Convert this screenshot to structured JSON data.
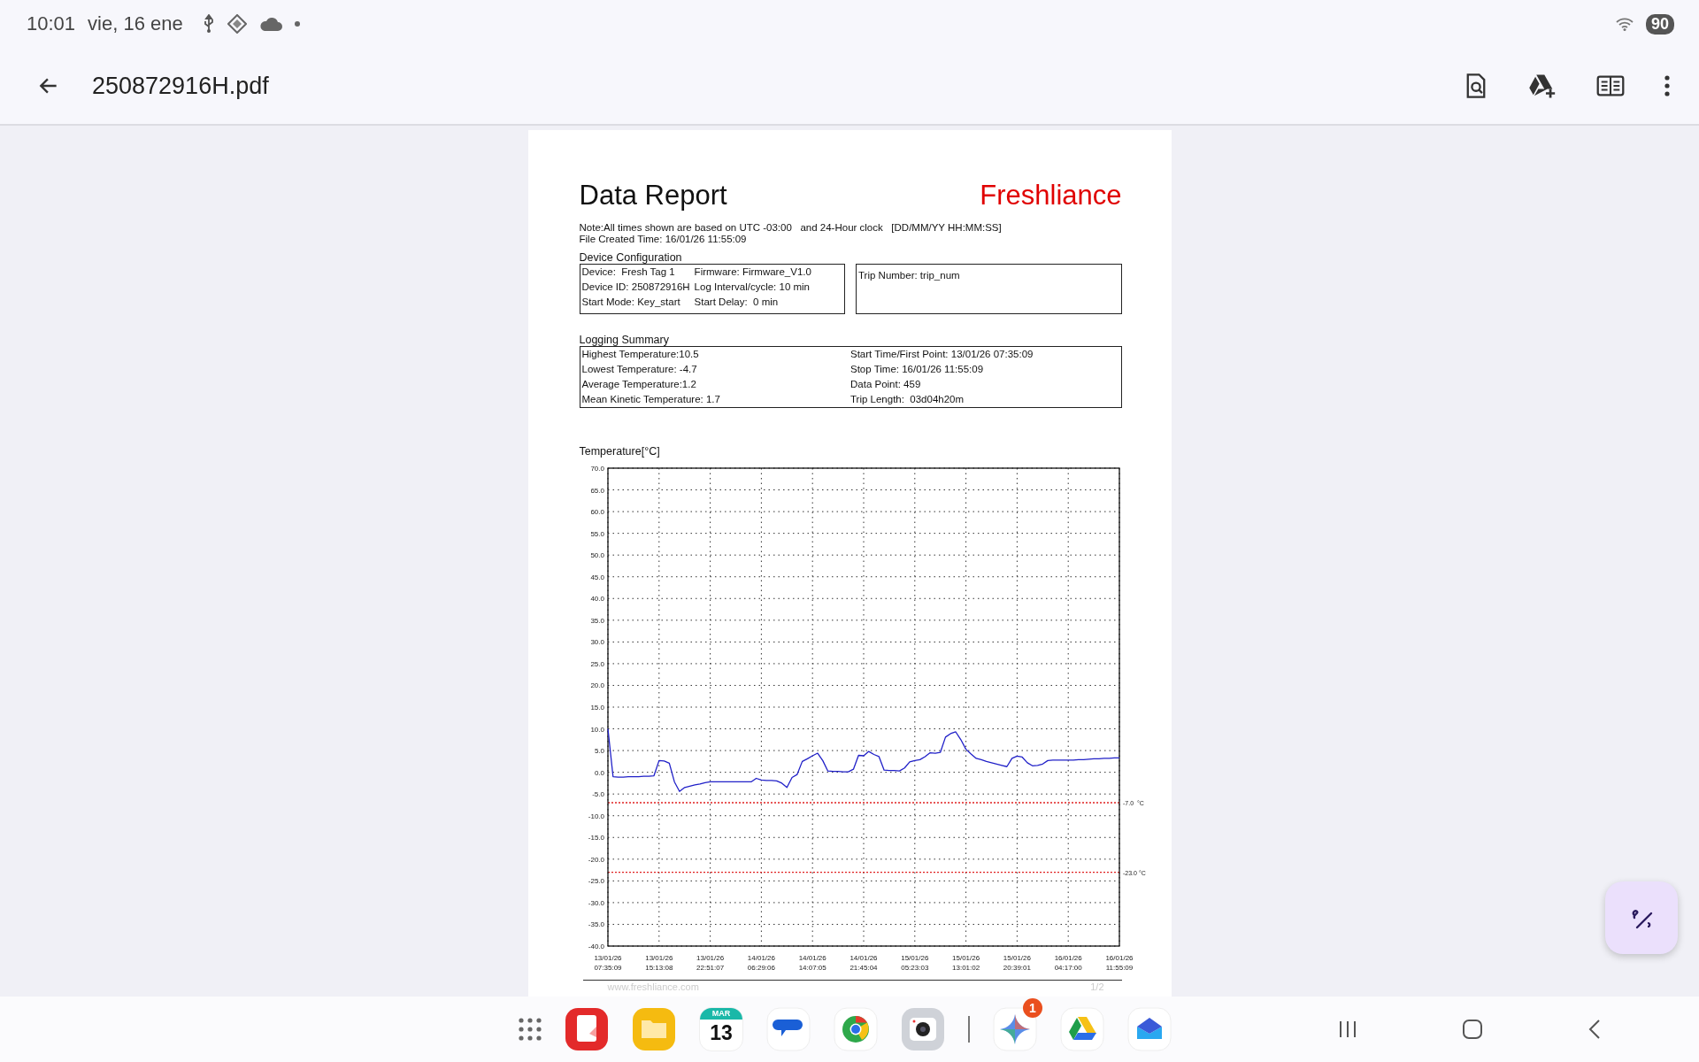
{
  "status_bar": {
    "time": "10:01",
    "date": "vie, 16 ene",
    "battery": "90"
  },
  "toolbar": {
    "title": "250872916H.pdf"
  },
  "report": {
    "title": "Data Report",
    "brand": "Freshliance",
    "note": "Note:All times shown are based on UTC -03:00   and 24-Hour clock   [DD/MM/YY HH:MM:SS]",
    "created": "File Created Time: 16/01/26 11:55:09",
    "device_config": {
      "heading": "Device Configuration",
      "rows": [
        [
          "Device:  Fresh Tag 1",
          "Firmware: Firmware_V1.0"
        ],
        [
          "Device ID: 250872916H",
          "Log Interval/cycle: 10 min"
        ],
        [
          "Start Mode: Key_start",
          "Start Delay:  0 min"
        ]
      ],
      "trip": "Trip Number: trip_num"
    },
    "logging_summary": {
      "heading": "Logging Summary",
      "left": [
        "Highest Temperature:10.5",
        "Lowest Temperature: -4.7",
        "Average Temperature:1.2",
        "Mean Kinetic Temperature: 1.7"
      ],
      "right": [
        "Start Time/First Point: 13/01/26 07:35:09",
        "Stop Time: 16/01/26 11:55:09",
        "Data Point: 459",
        "Trip Length:  03d04h20m"
      ]
    },
    "chart_data": {
      "type": "line",
      "title": "Temperature[°C]",
      "categories": [
        "13/01/26 07:35:09",
        null,
        null,
        null,
        null,
        null,
        null,
        null,
        null,
        null,
        "13/01/26 15:13:08",
        null,
        null,
        null,
        null,
        null,
        null,
        null,
        null,
        null,
        "13/01/26 22:51:07",
        null,
        null,
        null,
        null,
        null,
        null,
        null,
        null,
        null,
        "14/01/26 06:29:06",
        null,
        null,
        null,
        null,
        null,
        null,
        null,
        null,
        null,
        "14/01/26 14:07:05",
        null,
        null,
        null,
        null,
        null,
        null,
        null,
        null,
        null,
        "14/01/26 21:45:04",
        null,
        null,
        null,
        null,
        null,
        null,
        null,
        null,
        null,
        "15/01/26 05:23:03",
        null,
        null,
        null,
        null,
        null,
        null,
        null,
        null,
        null,
        "15/01/26 13:01:02",
        null,
        null,
        null,
        null,
        null,
        null,
        null,
        null,
        null,
        "15/01/26 20:39:01",
        null,
        null,
        null,
        null,
        null,
        null,
        null,
        null,
        null,
        "16/01/26 04:17:00",
        null,
        null,
        null,
        null,
        null,
        null,
        null,
        null,
        null,
        "16/01/26 11:55:09"
      ],
      "series": [
        {
          "color": "#2020c8",
          "values": [
            10,
            -1.0,
            -1.1,
            -1.1,
            -1.0,
            -1.0,
            -1.0,
            -0.9,
            -0.9,
            -0.8,
            2.7,
            2.6,
            2.1,
            -2.2,
            -4.4,
            -3.5,
            -3.2,
            -2.9,
            -2.7,
            -2.4,
            -2.2,
            -2.2,
            -2.2,
            -2.2,
            -2.2,
            -2.2,
            -2.2,
            -2.2,
            -2.2,
            -1.4,
            -1.8,
            -1.9,
            -1.9,
            -2.0,
            -2.5,
            -3.5,
            -1.2,
            -0.5,
            2.5,
            3.1,
            3.8,
            4.4,
            2.7,
            0.3,
            0.2,
            0.2,
            0.1,
            0.1,
            0.7,
            3.9,
            3.8,
            4.8,
            4.1,
            3.6,
            0.5,
            0.4,
            0.4,
            0.3,
            1.0,
            2.4,
            2.7,
            2.9,
            3.6,
            4.5,
            4.4,
            4.6,
            8.1,
            8.9,
            9.3,
            7.5,
            5.3,
            4.2,
            3.2,
            2.9,
            2.5,
            2.2,
            1.9,
            1.6,
            1.3,
            3.2,
            3.7,
            3.5,
            2.2,
            1.5,
            1.6,
            1.9,
            2.7,
            2.8,
            2.8,
            2.8,
            2.8,
            2.8,
            2.9,
            2.9,
            3.0,
            3.1,
            3.1,
            3.2,
            3.2,
            3.3,
            3.3
          ]
        }
      ],
      "ylim": [
        -40,
        70
      ],
      "yticks": [
        {
          "value": 70,
          "label": "70.0"
        },
        {
          "value": 65,
          "label": "65.0"
        },
        {
          "value": 60,
          "label": "60.0"
        },
        {
          "value": 55,
          "label": "55.0"
        },
        {
          "value": 50,
          "label": "50.0"
        },
        {
          "value": 45,
          "label": "45.0"
        },
        {
          "value": 40,
          "label": "40.0"
        },
        {
          "value": 35,
          "label": "35.0"
        },
        {
          "value": 30,
          "label": "30.0"
        },
        {
          "value": 25,
          "label": "25.0"
        },
        {
          "value": 20,
          "label": "20.0"
        },
        {
          "value": 15,
          "label": "15.0"
        },
        {
          "value": 10,
          "label": "10.0"
        },
        {
          "value": 5,
          "label": "5.0"
        },
        {
          "value": 0,
          "label": "0.0"
        },
        {
          "value": -5,
          "label": "-5.0"
        },
        {
          "value": -10,
          "label": "-10.0"
        },
        {
          "value": -15,
          "label": "-15.0"
        },
        {
          "value": -20,
          "label": "-20.0"
        },
        {
          "value": -25,
          "label": "-25.0"
        },
        {
          "value": -30,
          "label": "-30.0"
        },
        {
          "value": -35,
          "label": "-35.0"
        },
        {
          "value": -40,
          "label": "-40.0"
        }
      ],
      "grid": true,
      "ref_lines": [
        {
          "axis": "y",
          "value": -7,
          "label": "-7.0  °C"
        },
        {
          "axis": "y",
          "value": -23,
          "label": "-23.0 °C"
        }
      ]
    },
    "footer": {
      "site": "www.freshliance.com",
      "page": "1/2"
    }
  },
  "dock": {
    "calendar": {
      "month": "MAR",
      "day": "13"
    },
    "badge": "1"
  }
}
